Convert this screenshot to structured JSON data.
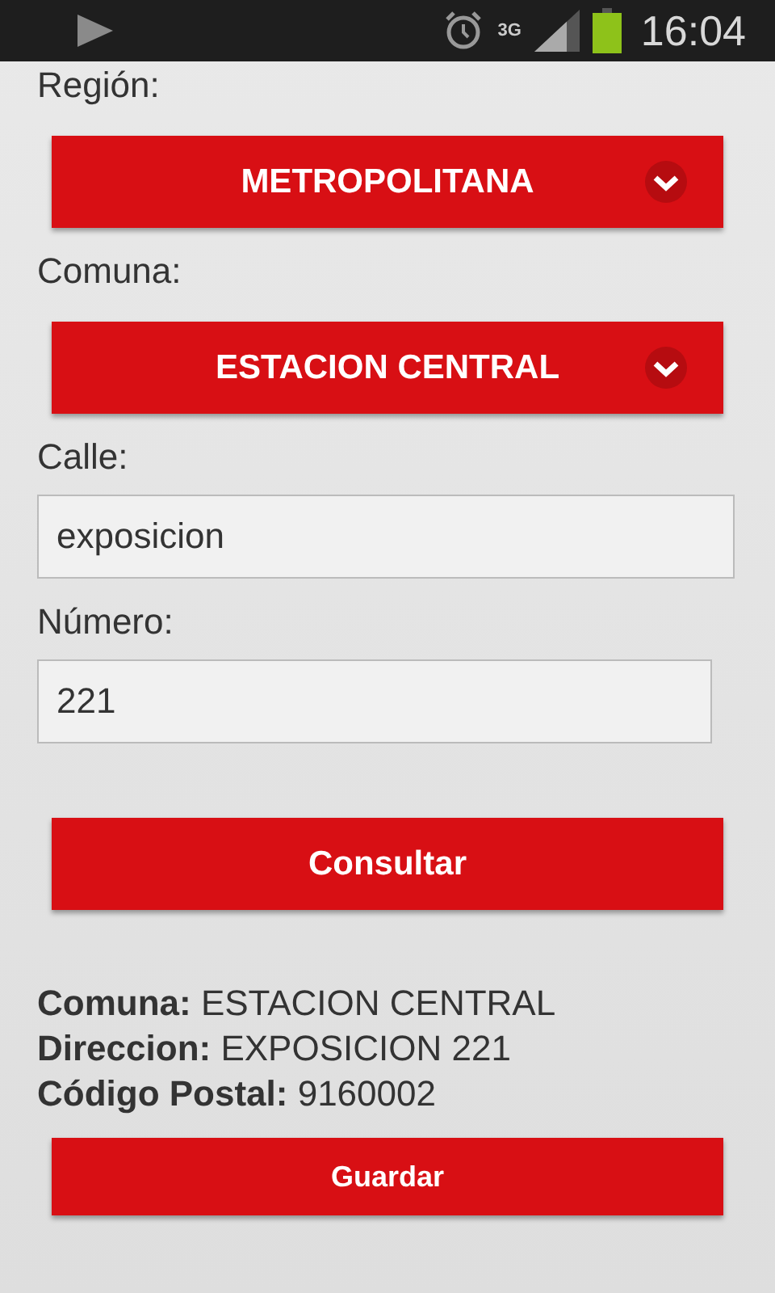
{
  "status_bar": {
    "network": "3G",
    "time": "16:04"
  },
  "form": [
    {
      "kind": "select",
      "label": "Región:",
      "value": "METROPOLITANA"
    },
    {
      "kind": "select",
      "label": "Comuna:",
      "value": "ESTACION CENTRAL"
    },
    {
      "kind": "input",
      "label": "Calle:",
      "value": "exposicion"
    },
    {
      "kind": "input",
      "label": "Número:",
      "value": "221"
    }
  ],
  "submit_button": "Consultar",
  "result": [
    "**Comuna:** ESTACION CENTRAL",
    "**Direccion:** EXPOSICION 221",
    "**Código Postal:** 9160002"
  ],
  "save_button": "Guardar"
}
